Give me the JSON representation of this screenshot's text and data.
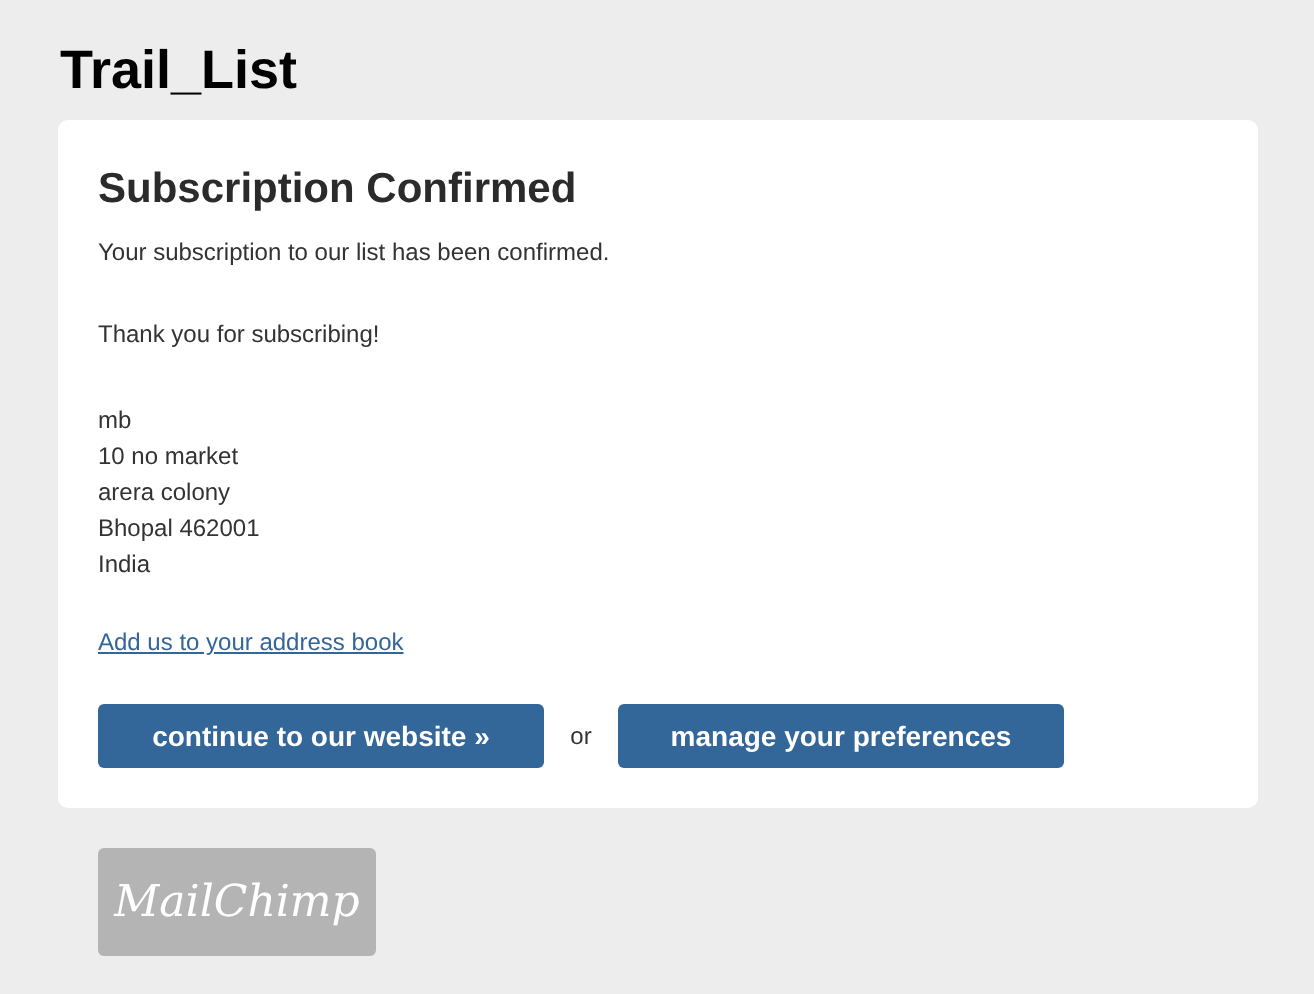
{
  "page_title": "Trail_List",
  "card": {
    "heading": "Subscription Confirmed",
    "paragraphs": [
      "Your subscription to our list has been confirmed.",
      "Thank you for subscribing!"
    ],
    "address_lines": [
      "mb",
      "10 no market",
      "arera colony",
      "Bhopal 462001",
      "India"
    ],
    "address_book_link": "Add us to your address book",
    "buttons": [
      "continue to our website »",
      "manage your preferences"
    ],
    "separator": "or"
  },
  "footer_badge": "MailChimp"
}
